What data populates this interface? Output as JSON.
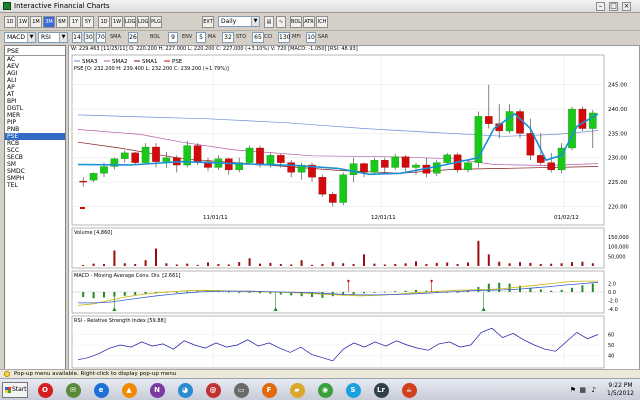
{
  "window": {
    "title": "Interactive Financial Charts"
  },
  "toolbar": {
    "buttons": [
      "1D",
      "1W",
      "1M",
      "3M",
      "6M",
      "1Y",
      "5Y",
      "1D",
      "1W",
      "LOG",
      "LOG",
      "PLG",
      "REL",
      "ATR",
      "ICH",
      "EXT",
      "BOL"
    ],
    "active_button": "3M",
    "interval": "Daily"
  },
  "toolbar2": {
    "indicator1": "MACD",
    "indicator2": "RSI",
    "values": [
      "14",
      "30",
      "70",
      "26",
      "9",
      "5",
      "32",
      "65",
      "130",
      "10"
    ],
    "labels": [
      "SMA",
      "BOL",
      "ENV",
      "MA",
      "STO",
      "CCI",
      "MFI",
      "SAR"
    ]
  },
  "sidebar": {
    "selected": "PSE",
    "items": [
      "AC",
      "AEV",
      "AGI",
      "ALI",
      "AP",
      "AT",
      "BPI",
      "DGTL",
      "MER",
      "PIP",
      "PNB",
      "PSE",
      "RCB",
      "SCC",
      "SECB",
      "SM",
      "SMDC",
      "SMPH",
      "TEL"
    ]
  },
  "info_line": "W: 229.463  [11/25/11]  O: 220.200  H: 227.000  L: 220.200  C: 227.000 (+3.10%)  V: 720  [MACD: -1.050]  [RSI: 48.93]",
  "legend": {
    "sma3": "SMA3",
    "sma2": "SMA2",
    "sma1": "SMA1",
    "pse": "PSE"
  },
  "price_header": "PSE [O: 232.200  H: 239.400  L: 232.200  C: 239.200 (+1.79%)]",
  "volume_label": "Volume [4,860]",
  "macd_label": "MACD - Moving Average Conv. Div. [2.661]",
  "rsi_label": "RSI - Relative Strength Index [59.88]",
  "date_labels": [
    "11/01/11",
    "12/01/11",
    "01/02/12"
  ],
  "colors": {
    "up": "#19c819",
    "down": "#d20a0a",
    "sma_blue": "#6a8fd6",
    "sma_purple": "#b35aa8",
    "sma_red": "#7e1a1a",
    "rsi": "#1a1aaa"
  },
  "chart_data": [
    {
      "type": "candlestick",
      "ylim": [
        217,
        247
      ],
      "y_ticks": [
        220,
        225,
        230,
        235,
        240,
        245
      ],
      "candles": [
        [
          225.2,
          226.0,
          224.0,
          225.0
        ],
        [
          225.4,
          227.0,
          225.0,
          226.8
        ],
        [
          226.8,
          229.0,
          226.0,
          228.2
        ],
        [
          228.2,
          230.0,
          227.6,
          229.8
        ],
        [
          229.8,
          231.5,
          229.0,
          231.0
        ],
        [
          231.0,
          231.2,
          228.5,
          229.0
        ],
        [
          229.0,
          233.0,
          228.8,
          232.2
        ],
        [
          232.2,
          233.0,
          228.0,
          229.2
        ],
        [
          229.2,
          231.2,
          228.0,
          230.0
        ],
        [
          230.0,
          230.5,
          227.0,
          228.5
        ],
        [
          228.5,
          233.5,
          228.0,
          232.5
        ],
        [
          232.5,
          233.0,
          228.5,
          229.2
        ],
        [
          229.2,
          230.0,
          227.2,
          228.0
        ],
        [
          228.0,
          230.5,
          227.5,
          229.8
        ],
        [
          229.8,
          230.0,
          226.5,
          227.5
        ],
        [
          227.5,
          230.0,
          227.0,
          229.0
        ],
        [
          229.0,
          232.5,
          228.8,
          232.0
        ],
        [
          232.0,
          232.5,
          228.0,
          228.5
        ],
        [
          228.5,
          231.0,
          228.0,
          230.5
        ],
        [
          230.5,
          230.8,
          228.0,
          229.0
        ],
        [
          229.0,
          229.5,
          226.0,
          227.0
        ],
        [
          227.0,
          229.0,
          225.5,
          228.5
        ],
        [
          228.5,
          229.0,
          225.0,
          226.0
        ],
        [
          226.0,
          226.5,
          222.0,
          222.5
        ],
        [
          222.5,
          223.0,
          220.0,
          220.8
        ],
        [
          220.8,
          227.0,
          220.2,
          226.5
        ],
        [
          226.5,
          230.0,
          225.0,
          228.8
        ],
        [
          228.8,
          229.0,
          226.0,
          227.0
        ],
        [
          227.0,
          230.0,
          226.5,
          229.5
        ],
        [
          229.5,
          230.0,
          227.0,
          228.0
        ],
        [
          228.0,
          230.8,
          227.5,
          230.2
        ],
        [
          230.2,
          230.5,
          227.2,
          228.0
        ],
        [
          228.0,
          229.0,
          226.5,
          228.5
        ],
        [
          228.5,
          230.0,
          226.0,
          226.8
        ],
        [
          226.8,
          229.5,
          226.2,
          229.0
        ],
        [
          229.0,
          231.0,
          228.5,
          230.6
        ],
        [
          230.6,
          231.0,
          227.0,
          227.5
        ],
        [
          227.5,
          229.5,
          227.0,
          229.0
        ],
        [
          229.0,
          239.5,
          228.0,
          238.5
        ],
        [
          238.5,
          245.0,
          236.0,
          237.0
        ],
        [
          237.0,
          241.0,
          234.0,
          235.5
        ],
        [
          235.5,
          241.0,
          235.0,
          239.5
        ],
        [
          239.5,
          240.0,
          234.0,
          235.0
        ],
        [
          235.0,
          238.0,
          229.5,
          230.5
        ],
        [
          230.5,
          235.0,
          228.5,
          229.0
        ],
        [
          229.0,
          231.0,
          227.0,
          227.5
        ],
        [
          227.5,
          233.0,
          226.8,
          232.0
        ],
        [
          232.0,
          240.5,
          231.5,
          240.0
        ],
        [
          240.0,
          240.5,
          235.5,
          236.0
        ],
        [
          236.0,
          239.8,
          232.0,
          239.2
        ]
      ],
      "sma_blue": [
        [
          0,
          238.8
        ],
        [
          0.12,
          238.4
        ],
        [
          0.25,
          238.0
        ],
        [
          0.4,
          237.2
        ],
        [
          0.55,
          236.0
        ],
        [
          0.68,
          235.2
        ],
        [
          0.82,
          234.4
        ],
        [
          0.92,
          234.8
        ],
        [
          1,
          235.6
        ]
      ],
      "sma_purple": [
        [
          0,
          235.8
        ],
        [
          0.12,
          234.8
        ],
        [
          0.2,
          233.2
        ],
        [
          0.3,
          231.6
        ],
        [
          0.45,
          230.4
        ],
        [
          0.6,
          230.2
        ],
        [
          0.72,
          229.8
        ],
        [
          0.8,
          228.6
        ],
        [
          0.9,
          228.4
        ],
        [
          1,
          228.8
        ]
      ],
      "sma_red": [
        [
          0,
          233.2
        ],
        [
          0.08,
          232.0
        ],
        [
          0.2,
          229.8
        ],
        [
          0.35,
          228.6
        ],
        [
          0.5,
          227.4
        ],
        [
          0.62,
          226.8
        ],
        [
          0.72,
          227.6
        ],
        [
          0.82,
          227.8
        ],
        [
          1,
          228.2
        ]
      ],
      "sma3_points": [
        [
          0,
          228.6
        ],
        [
          0.1,
          228.5
        ],
        [
          0.2,
          229.2
        ],
        [
          0.3,
          228.8
        ],
        [
          0.42,
          228.4
        ],
        [
          0.5,
          227.8
        ],
        [
          0.56,
          226.6
        ],
        [
          0.62,
          226.8
        ],
        [
          0.7,
          228.4
        ],
        [
          0.77,
          230.0
        ],
        [
          0.8,
          236.0
        ],
        [
          0.84,
          239.0
        ],
        [
          0.87,
          236.0
        ],
        [
          0.9,
          229.5
        ],
        [
          0.93,
          230.5
        ],
        [
          0.96,
          236.5
        ],
        [
          1,
          239.0
        ]
      ]
    },
    {
      "type": "bar",
      "name": "Volume",
      "y_ticks": [
        50000,
        100000,
        150000
      ],
      "y_tick_labels": [
        "50,000",
        "100,000",
        "150,000"
      ],
      "values": [
        5,
        12,
        10,
        80,
        14,
        10,
        30,
        90,
        14,
        8,
        12,
        6,
        18,
        10,
        8,
        20,
        40,
        12,
        16,
        10,
        8,
        30,
        6,
        10,
        20,
        14,
        10,
        60,
        12,
        8,
        10,
        14,
        24,
        10,
        16,
        18,
        10,
        18,
        130,
        60,
        22,
        14,
        20,
        16,
        10,
        12,
        14,
        20,
        22,
        14
      ]
    },
    {
      "type": "bar",
      "name": "MACD",
      "y_ticks": [
        2,
        0,
        -2,
        -4
      ],
      "y_tick_labels": [
        "2.0",
        "0.0",
        "-2.0",
        "-4.0"
      ],
      "values": [
        -1.2,
        -1.5,
        -1.3,
        -1.1,
        -0.9,
        -0.7,
        -0.5,
        -0.3,
        -0.2,
        -0.1,
        0.1,
        0.2,
        0.3,
        0.2,
        0.1,
        0.0,
        -0.1,
        -0.3,
        -0.4,
        -0.6,
        -0.8,
        -1.0,
        -1.2,
        -1.4,
        -1.0,
        -0.8,
        -0.5,
        -0.3,
        -0.1,
        0.1,
        0.2,
        0.3,
        0.5,
        0.3,
        0.1,
        -0.1,
        -0.2,
        0.3,
        1.2,
        2.0,
        2.2,
        2.0,
        1.5,
        1.0,
        0.6,
        0.3,
        0.5,
        1.0,
        1.6,
        2.0
      ],
      "series_macd": [
        -3.2,
        -2.8,
        -2.0,
        -1.2,
        -0.6,
        -0.2,
        0.1,
        0.3,
        0.4,
        0.3,
        0.2,
        0.1,
        0.0,
        -0.1,
        -0.2,
        -0.4,
        -0.6,
        -0.8,
        -0.9,
        -0.8,
        -0.6,
        -0.3,
        0.0,
        0.2,
        0.4,
        0.5,
        0.6,
        0.8,
        1.2,
        1.6,
        2.0,
        2.4,
        2.6,
        2.6
      ],
      "series_signal": [
        -2.6,
        -2.6,
        -2.4,
        -1.9,
        -1.4,
        -0.9,
        -0.5,
        -0.2,
        0.1,
        0.2,
        0.2,
        0.2,
        0.1,
        0.0,
        -0.1,
        -0.2,
        -0.4,
        -0.6,
        -0.7,
        -0.7,
        -0.6,
        -0.5,
        -0.3,
        -0.1,
        0.1,
        0.3,
        0.4,
        0.5,
        0.7,
        1.0,
        1.3,
        1.7,
        2.0,
        2.3
      ]
    },
    {
      "type": "line",
      "name": "RSI",
      "ylim": [
        30,
        70
      ],
      "y_ticks": [
        40,
        50,
        60
      ],
      "values": [
        36,
        38,
        42,
        47,
        50,
        48,
        53,
        49,
        51,
        46,
        54,
        50,
        47,
        52,
        48,
        50,
        55,
        49,
        52,
        47,
        43,
        48,
        41,
        38,
        35,
        46,
        52,
        48,
        53,
        49,
        54,
        50,
        47,
        45,
        51,
        53,
        48,
        50,
        62,
        66,
        57,
        61,
        55,
        50,
        46,
        44,
        53,
        62,
        56,
        60
      ]
    }
  ],
  "status": {
    "text": "Pop-up menu available. Right-click to display pop-up menu"
  },
  "taskbar": {
    "start": "Start",
    "apps": [
      {
        "icon": "opera-icon",
        "glyph": "O",
        "color": "#d61e1e"
      },
      {
        "icon": "mail-icon",
        "glyph": "✉",
        "color": "#5a8a3a"
      },
      {
        "icon": "internet-explorer-icon",
        "glyph": "e",
        "color": "#1e6fd6"
      },
      {
        "icon": "vlc-icon",
        "glyph": "▲",
        "color": "#f08a00"
      },
      {
        "icon": "onenote-icon",
        "glyph": "N",
        "color": "#7a3aa0"
      },
      {
        "icon": "messenger-icon",
        "glyph": "◕",
        "color": "#2a8bd0"
      },
      {
        "icon": "email-client-icon",
        "glyph": "@",
        "color": "#c03030"
      },
      {
        "icon": "hard-drive-icon",
        "glyph": "▭",
        "color": "#6a6a6a"
      },
      {
        "icon": "firefox-icon",
        "glyph": "F",
        "color": "#e06a10"
      },
      {
        "icon": "folder-icon",
        "glyph": "▰",
        "color": "#d9a82a"
      },
      {
        "icon": "chrome-icon",
        "glyph": "◉",
        "color": "#3aa03a"
      },
      {
        "icon": "skype-icon",
        "glyph": "S",
        "color": "#1aa1e0"
      },
      {
        "icon": "lightroom-icon",
        "glyph": "Lr",
        "color": "#30404a"
      },
      {
        "icon": "java-icon",
        "glyph": "☕",
        "color": "#d04020"
      }
    ],
    "time": "9:22 PM",
    "date": "1/5/2012"
  }
}
